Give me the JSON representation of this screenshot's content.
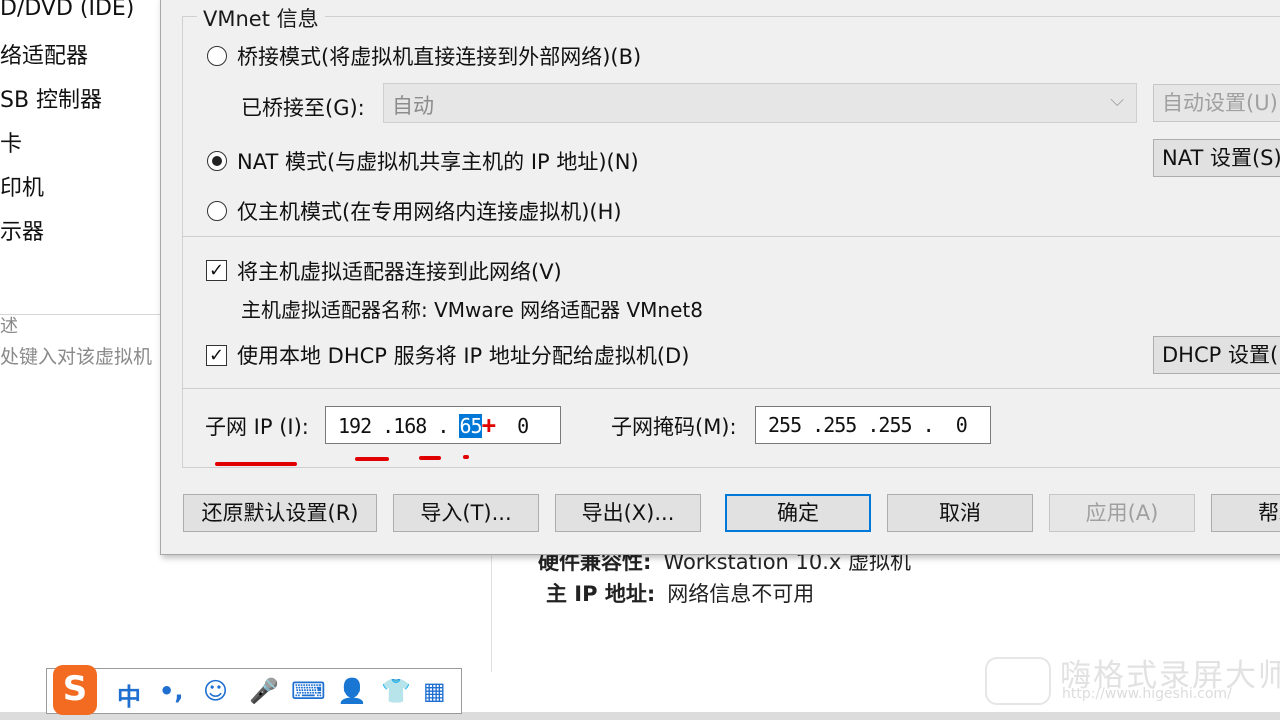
{
  "left_panel": {
    "items": [
      "D/DVD (IDE)",
      "络适配器",
      "SB 控制器",
      "卡",
      "印机",
      "示器"
    ],
    "separator_mark": "述",
    "hint": "处键入对该虚拟机"
  },
  "vm_info": {
    "compat_label": "硬件兼容性:",
    "compat_value": "Workstation 10.x 虚拟机",
    "ip_label": "主 IP 地址:",
    "ip_value": "网络信息不可用"
  },
  "dialog": {
    "group_title": "VMnet 信息",
    "bridged": {
      "label": "桥接模式(将虚拟机直接连接到外部网络)(B)",
      "bridged_to_label": "已桥接至(G):",
      "bridged_to_value": "自动",
      "auto_settings_button": "自动设置(U)..."
    },
    "nat": {
      "label": "NAT 模式(与虚拟机共享主机的 IP 地址)(N)",
      "settings_button": "NAT 设置(S)..."
    },
    "host_only": {
      "label": "仅主机模式(在专用网络内连接虚拟机)(H)"
    },
    "connect_adapter": {
      "label": "将主机虚拟适配器连接到此网络(V)",
      "adapter_name_label": "主机虚拟适配器名称:",
      "adapter_name_value": "VMware 网络适配器 VMnet8"
    },
    "dhcp": {
      "label": "使用本地 DHCP 服务将 IP 地址分配给虚拟机(D)",
      "settings_button": "DHCP 设置(P)..."
    },
    "subnet_ip": {
      "label": "子网 IP (I):",
      "o1": "192",
      "o2": "168",
      "o3": "65",
      "o4": "0"
    },
    "subnet_mask": {
      "label": "子网掩码(M):",
      "value": "255 .255 .255 .  0"
    },
    "buttons": {
      "restore": "还原默认设置(R)",
      "import": "导入(T)...",
      "export": "导出(X)...",
      "ok": "确定",
      "cancel": "取消",
      "apply": "应用(A)",
      "help": "帮助"
    },
    "selection": {
      "bridged": false,
      "nat": true,
      "host_only": false,
      "connect_adapter": true,
      "dhcp": true
    }
  },
  "ime": {
    "logo": "S",
    "mode": "中",
    "punct": "•,",
    "emoji": "☺",
    "mic": "🎤",
    "keyboard": "⌨",
    "user": "👤",
    "shirt": "👕",
    "grid": "▦"
  },
  "watermark": {
    "title": "嗨格式录屏大师",
    "url": "http://www.higeshi.com/"
  },
  "colors": {
    "annotation_red": "#e00000",
    "selection_blue": "#0078d7",
    "ime_orange": "#f36b21"
  }
}
